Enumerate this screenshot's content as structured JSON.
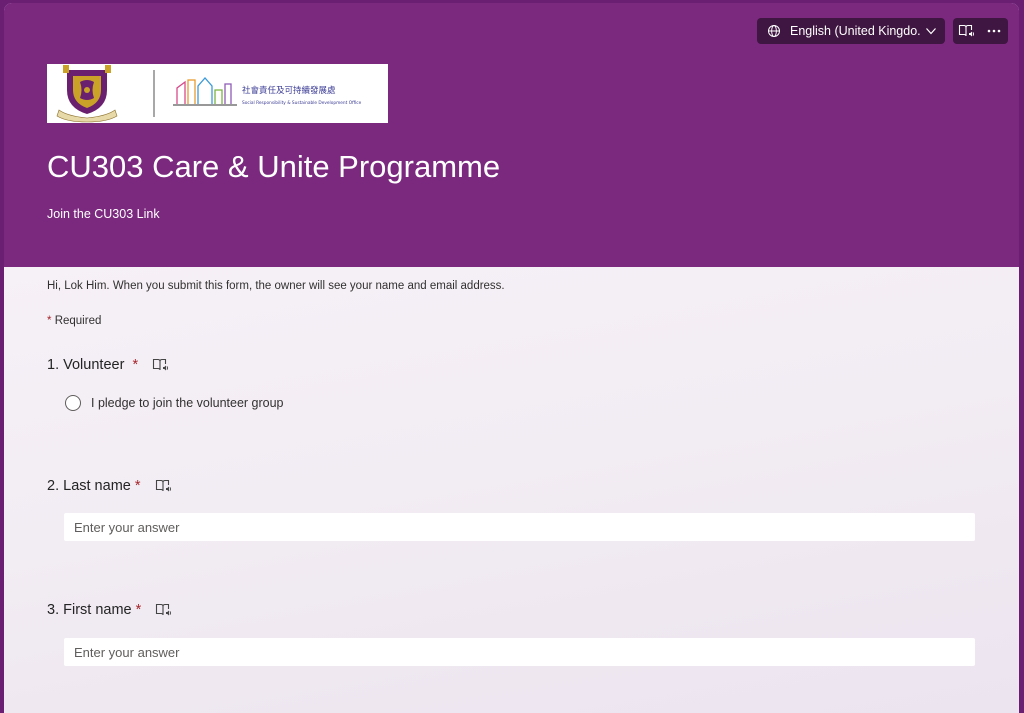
{
  "header": {
    "language_label": "English (United Kingdo...",
    "title": "CU303 Care & Unite Programme",
    "subtitle": "Join the CU303 Link",
    "logo": {
      "chinese_text": "社會責任及可持續發展處",
      "english_text": "Social Responsibility & Sustainable Development Office"
    },
    "icons": [
      "globe-icon",
      "chevron-down-icon",
      "immersive-reader-icon",
      "more-options-icon"
    ]
  },
  "form": {
    "notice": "Hi, Lok Him. When you submit this form, the owner will see your name and email address.",
    "required_marker": "*",
    "required_label": "Required",
    "questions": [
      {
        "number": "1.",
        "label": "Volunteer",
        "required": "*",
        "option": "I pledge to join the volunteer group"
      },
      {
        "number": "2.",
        "label": "Last name",
        "required": "*",
        "placeholder": "Enter your answer"
      },
      {
        "number": "3.",
        "label": "First name",
        "required": "*",
        "placeholder": "Enter your answer"
      }
    ]
  },
  "colors": {
    "header_purple": "#7b287f",
    "toolbar_dark": "#3f1541",
    "required_red": "#a4262c"
  }
}
